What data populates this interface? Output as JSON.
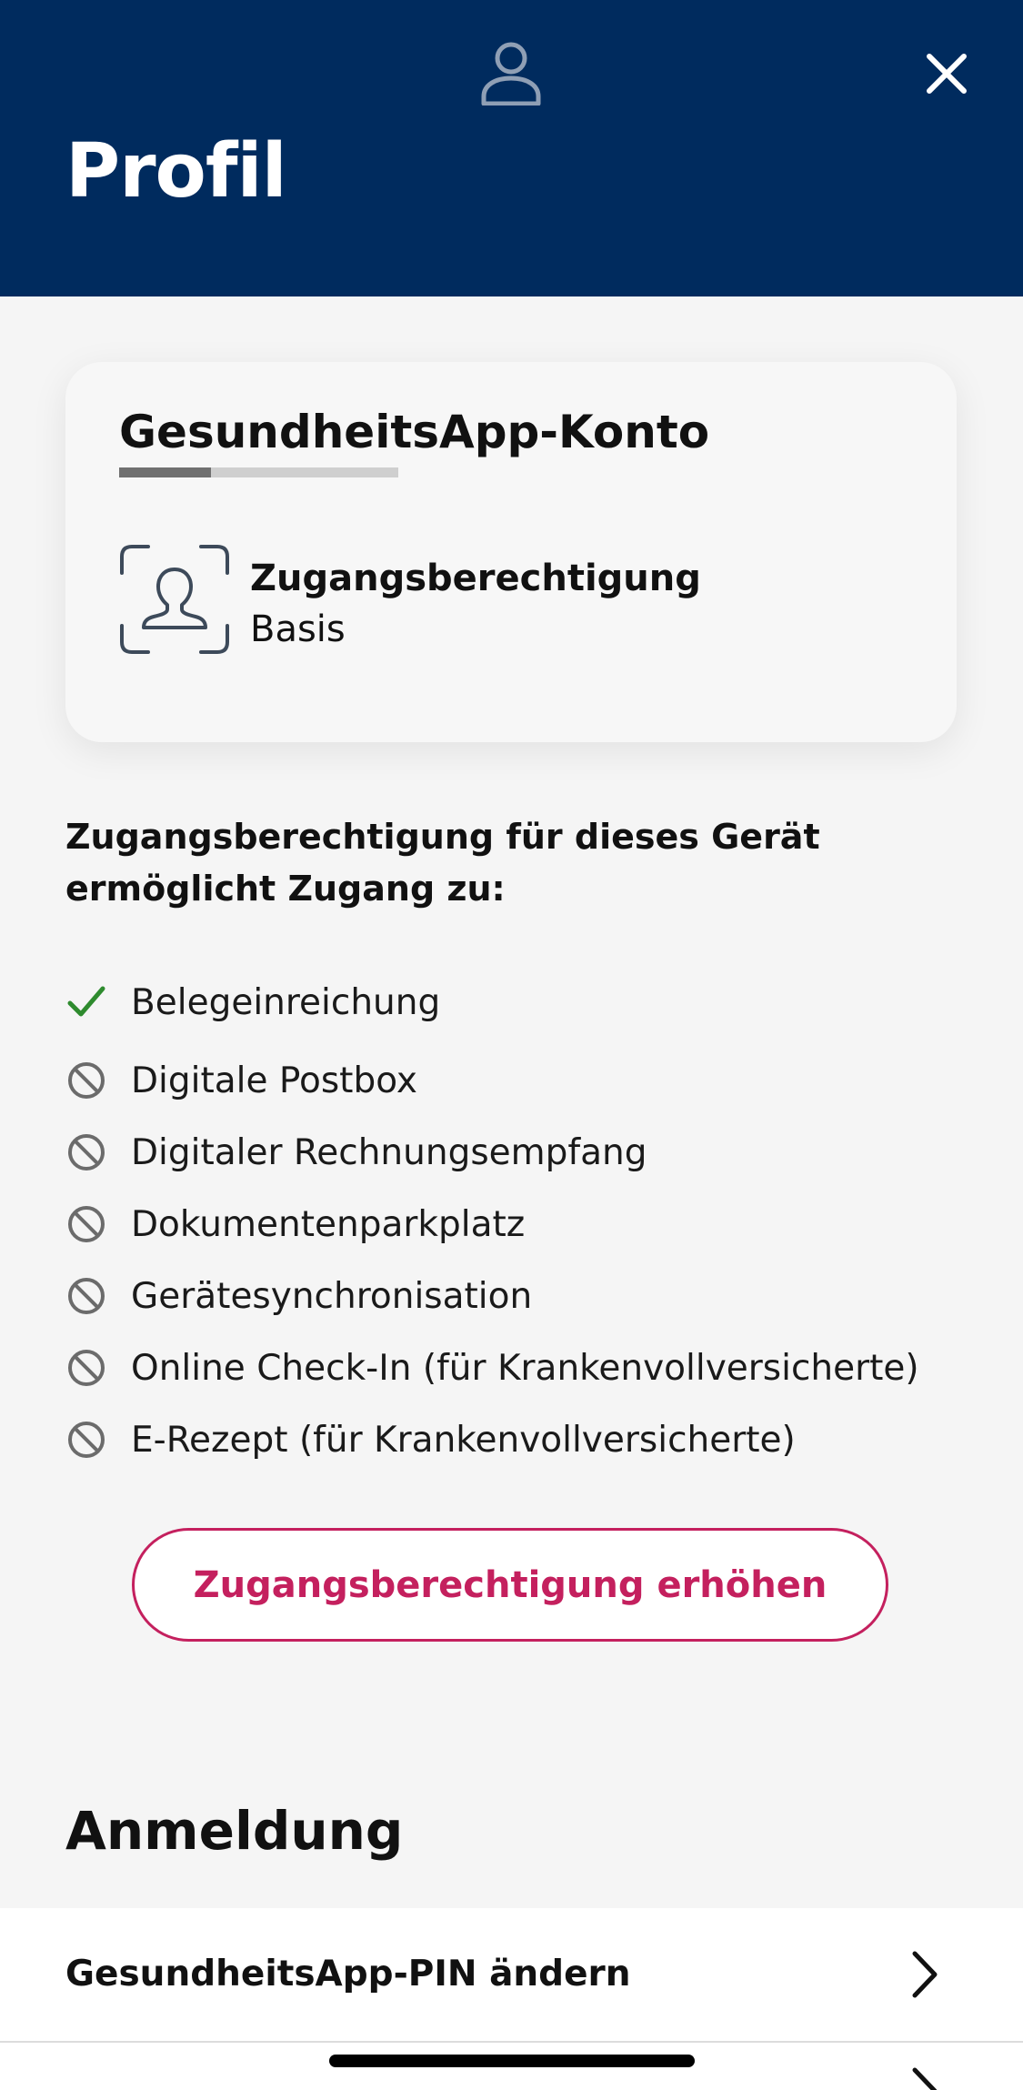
{
  "header": {
    "title": "Profil",
    "avatar_icon": "person-outline-icon",
    "close_icon": "close-icon",
    "background_color": "#002b5e"
  },
  "account_card": {
    "title": "GesundheitsApp-Konto",
    "progress_fraction": 0.33,
    "access_icon": "person-frame-icon",
    "access_label": "Zugangsberechtigung",
    "access_level": "Basis"
  },
  "access_info": {
    "heading": "Zugangsberechtigung für dieses Gerät ermöglicht Zugang zu:",
    "features": [
      {
        "label": "Belegeinreichung",
        "enabled": true,
        "icon": "check-icon"
      },
      {
        "label": "Digitale Postbox",
        "enabled": false,
        "icon": "blocked-icon"
      },
      {
        "label": "Digitaler Rechnungsempfang",
        "enabled": false,
        "icon": "blocked-icon"
      },
      {
        "label": "Dokumentenparkplatz",
        "enabled": false,
        "icon": "blocked-icon"
      },
      {
        "label": "Gerätesynchronisation",
        "enabled": false,
        "icon": "blocked-icon"
      },
      {
        "label": "Online Check-In (für Krankenvollversicherte)",
        "enabled": false,
        "icon": "blocked-icon"
      },
      {
        "label": "E-Rezept (für Krankenvollversicherte)",
        "enabled": false,
        "icon": "blocked-icon"
      }
    ]
  },
  "actions": {
    "raise_access_label": "Zugangsberechtigung erhöhen",
    "accent_color": "#c4205e"
  },
  "login_section": {
    "title": "Anmeldung",
    "items": [
      {
        "label": "GesundheitsApp-PIN ändern",
        "icon": "chevron-right-icon"
      }
    ]
  }
}
